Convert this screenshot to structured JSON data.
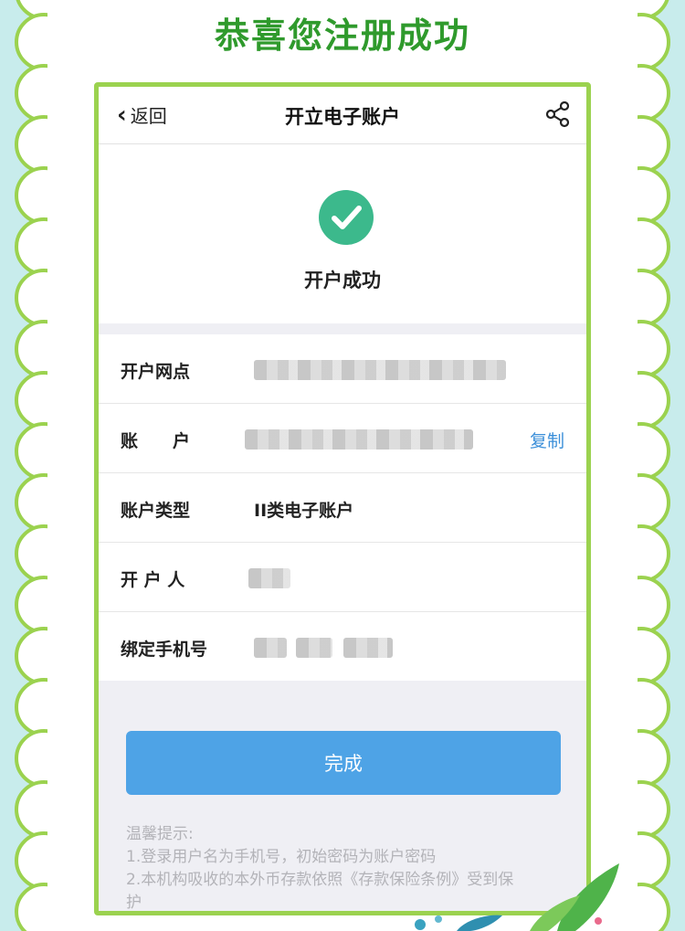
{
  "headline": "恭喜您注册成功",
  "nav": {
    "back_label": "返回",
    "title": "开立电子账户",
    "back_icon": "chevron-left-icon",
    "share_icon": "share-icon"
  },
  "success": {
    "icon": "check-circle-icon",
    "text": "开户成功"
  },
  "rows": [
    {
      "label": "开户网点",
      "value": ""
    },
    {
      "label": "账　　户",
      "value": "",
      "action": "复制"
    },
    {
      "label": "账户类型",
      "value": "II类电子账户"
    },
    {
      "label": "开 户 人",
      "value": ""
    },
    {
      "label": "绑定手机号",
      "value": ""
    }
  ],
  "done_button": "完成",
  "tips": {
    "title": "温馨提示:",
    "lines": [
      "1.登录用户名为手机号，初始密码为账户密码",
      "2.本机构吸收的本外币存款依照《存款保险条例》受到保",
      "护"
    ]
  },
  "colors": {
    "headline_green": "#2f9a2c",
    "frame_green": "#9bd24f",
    "background_blue": "#c8ecec",
    "accent_blue": "#4ea3e6",
    "check_green": "#3cb98c"
  }
}
